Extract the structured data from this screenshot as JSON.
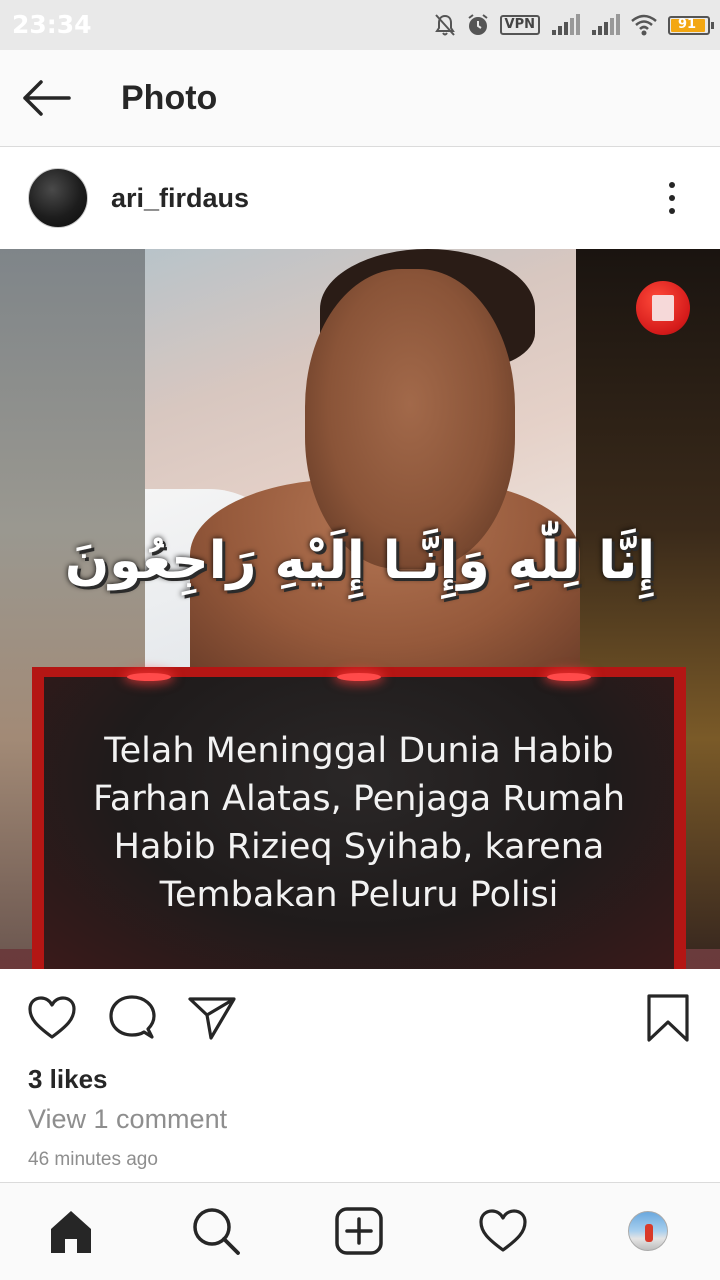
{
  "status_bar": {
    "time": "23:34",
    "vpn_label": "VPN",
    "battery_level": "91",
    "icons": [
      "notifications-off-icon",
      "alarm-icon",
      "vpn-icon",
      "signal-icon",
      "signal-icon",
      "wifi-icon",
      "battery-icon"
    ]
  },
  "app_bar": {
    "title": "Photo",
    "back_icon": "arrow-left-icon"
  },
  "post": {
    "username": "ari_firdaus",
    "more_icon": "more-vertical-icon",
    "image": {
      "arabic_text": "إِنَّا لِلّٰهِ وَإِنَّـا إِلَيْهِ رَاجِعُونَ",
      "caption": "Telah Meninggal Dunia Habib Farhan Alatas, Penjaga Rumah Habib Rizieq Syihab, karena Tembakan Peluru Polisi",
      "badge_color": "#d41a1a",
      "frame_color": "#b41614"
    },
    "actions": [
      "heart-icon",
      "comment-icon",
      "share-icon",
      "bookmark-icon"
    ],
    "likes": "3 likes",
    "view_comments": "View 1 comment",
    "timestamp": "46 minutes ago"
  },
  "bottom_nav": {
    "items": [
      "home-icon",
      "search-icon",
      "add-post-icon",
      "activity-heart-icon",
      "profile-avatar"
    ],
    "active": "home-icon"
  }
}
